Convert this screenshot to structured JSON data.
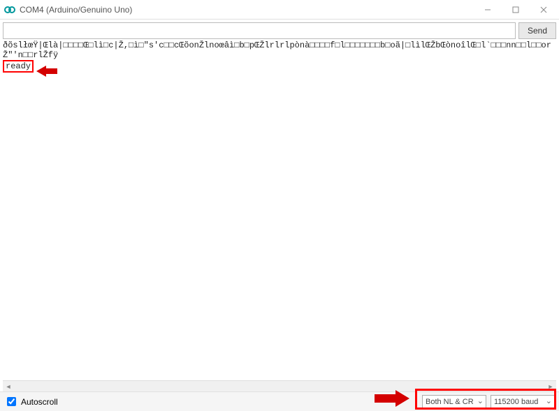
{
  "window": {
    "title": "COM4 (Arduino/Genuino Uno)"
  },
  "toolbar": {
    "send_label": "Send",
    "input_value": ""
  },
  "output": {
    "garbage_line": "ðõslłœŸ|Œlà|□□□□Œ□lì□c|Ž,□ì□\"s'c□□cŒõonŽlnoœâì□b□pŒŽlrlrlpònà□□□□f□l□□□□□□□b□oã|□lìlŒŽbŒònoîlŒ□l`□□□nn□□l□□orŽ\"'n□□rlŽfÿ",
    "ready": "ready"
  },
  "footer": {
    "autoscroll_label": "Autoscroll",
    "autoscroll_checked": true,
    "line_ending": "Both NL & CR",
    "baud": "115200 baud"
  }
}
